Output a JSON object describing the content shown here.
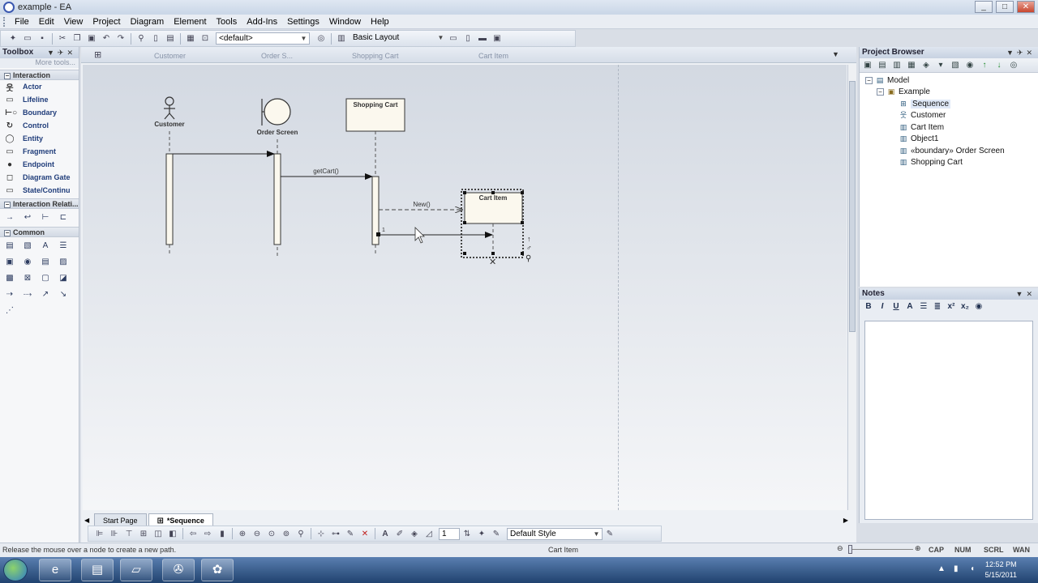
{
  "window": {
    "title": "example - EA",
    "controls": [
      "_",
      "□",
      "✕"
    ]
  },
  "menu": [
    "File",
    "Edit",
    "View",
    "Project",
    "Diagram",
    "Element",
    "Tools",
    "Add-Ins",
    "Settings",
    "Window",
    "Help"
  ],
  "toolbar": {
    "default_combo": "<default>",
    "layout_combo": "Basic Layout"
  },
  "toolbox": {
    "title": "Toolbox",
    "more_tools": "More tools...",
    "interaction_header": "Interaction",
    "interaction_items": [
      "Actor",
      "Lifeline",
      "Boundary",
      "Control",
      "Entity",
      "Fragment",
      "Endpoint",
      "Diagram Gate",
      "State/Continu"
    ],
    "relations_header": "Interaction Relati...",
    "common_header": "Common"
  },
  "diagram": {
    "top_tabs": [
      "Customer",
      "Order S...",
      "Shopping Cart",
      "Cart Item"
    ],
    "customer_label": "Customer",
    "order_screen_label": "Order Screen",
    "shopping_cart_label": "Shopping Cart",
    "cart_item_label": "Cart Item",
    "get_cart_label": "getCart()",
    "new_label": "New()",
    "msg_number": "1",
    "bottom_tabs": [
      "Start Page",
      "*Sequence"
    ],
    "style_combo": "Default Style",
    "zoom_value": "1"
  },
  "project_browser": {
    "title": "Project Browser",
    "tree": [
      {
        "label": "Model",
        "level": 0,
        "icon": "folder-icon"
      },
      {
        "label": "Example",
        "level": 1,
        "icon": "package-icon"
      },
      {
        "label": "Sequence",
        "level": 2,
        "icon": "diagram-icon",
        "selected": true
      },
      {
        "label": "Customer",
        "level": 2,
        "icon": "actor-icon"
      },
      {
        "label": "Cart Item",
        "level": 2,
        "icon": "object-icon"
      },
      {
        "label": "Object1",
        "level": 2,
        "icon": "object-icon"
      },
      {
        "label": "«boundary» Order Screen",
        "level": 2,
        "icon": "object-icon"
      },
      {
        "label": "Shopping Cart",
        "level": 2,
        "icon": "object-icon"
      }
    ]
  },
  "notes": {
    "title": "Notes"
  },
  "status": {
    "message": "Release the mouse over a node to create a new path.",
    "context": "Cart Item",
    "indicators": [
      "CAP",
      "NUM",
      "SCRL",
      "WAN"
    ]
  },
  "taskbar": {
    "time": "12:52 PM",
    "date": "5/15/2011"
  }
}
